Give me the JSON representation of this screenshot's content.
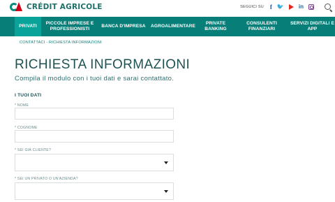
{
  "brand": {
    "name": "CRÉDIT AGRICOLE",
    "logo_icon": "credit-agricole-logo-icon",
    "colors": {
      "primary": "#077f78",
      "active": "#0aa399",
      "logo_green": "#0a8a7e",
      "logo_red": "#d2001b"
    }
  },
  "social": {
    "label": "SEGUICI SU",
    "icons": [
      "facebook-icon",
      "twitter-icon",
      "youtube-icon",
      "linkedin-icon",
      "instagram-icon"
    ],
    "facebook": "f",
    "twitter": "🐦",
    "linkedin": "in"
  },
  "nav": {
    "items": [
      {
        "label": "PRIVATI",
        "active": true
      },
      {
        "label": "PICCOLE IMPRESE E PROFESSIONISTI"
      },
      {
        "label": "BANCA D'IMPRESA"
      },
      {
        "label": "AGROALIMENTARE"
      },
      {
        "label": "PRIVATE BANKING"
      },
      {
        "label": "CONSULENTI FINANZIARI"
      },
      {
        "label": "SERVIZI DIGITALI E APP"
      }
    ]
  },
  "breadcrumb": "CONTATTACI - RICHIESTA INFORMAZIONI",
  "page": {
    "title": "RICHIESTA INFORMAZIONI",
    "subtitle": "Compila il modulo con i tuoi dati e sarai contattato."
  },
  "form": {
    "section_title": "I TUOI DATI",
    "fields": [
      {
        "label": "* NOME",
        "value": ""
      },
      {
        "label": "* COGNOME",
        "value": ""
      },
      {
        "label": "* SEI GIÀ CLIENTE?",
        "value": ""
      },
      {
        "label": "* SEI UN PRIVATO O UN'AZIENDA?",
        "value": ""
      }
    ]
  }
}
